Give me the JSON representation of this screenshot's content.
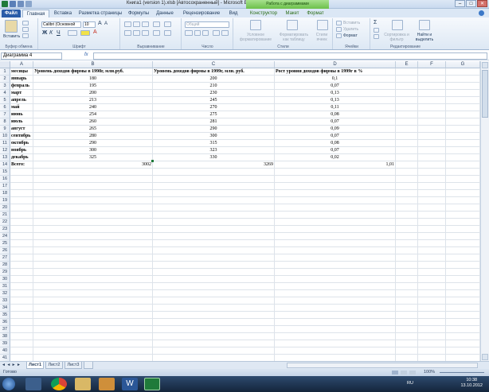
{
  "window": {
    "title": "Книга1 (version 1).xlsb [Автосохраненный] - Microsoft Excel",
    "context_title": "Работа с диаграммами"
  },
  "tabs": [
    {
      "id": "file",
      "label": "Файл"
    },
    {
      "id": "home",
      "label": "Главная"
    },
    {
      "id": "insert",
      "label": "Вставка"
    },
    {
      "id": "layout",
      "label": "Разметка страницы"
    },
    {
      "id": "formulas",
      "label": "Формулы"
    },
    {
      "id": "data",
      "label": "Данные"
    },
    {
      "id": "review",
      "label": "Рецензирование"
    },
    {
      "id": "view",
      "label": "Вид"
    },
    {
      "id": "design",
      "label": "Конструктор"
    },
    {
      "id": "chartlayout",
      "label": "Макет"
    },
    {
      "id": "format",
      "label": "Формат"
    }
  ],
  "ribbon": {
    "paste": "Вставить",
    "font_name": "Calibri (Основной",
    "font_size": "10",
    "number_format": "Общий",
    "cond_format": "Условное форматирование",
    "format_table": "Форматировать как таблицу",
    "cell_styles": "Стили ячеек",
    "insert": "Вставить",
    "delete": "Удалить",
    "format": "Формат",
    "sort": "Сортировка и фильтр",
    "find": "Найти и выделить",
    "groups": {
      "clipboard": "Буфер обмена",
      "font": "Шрифт",
      "alignment": "Выравнивание",
      "number": "Число",
      "styles": "Стили",
      "cells": "Ячейки",
      "editing": "Редактирование"
    }
  },
  "formula_bar": {
    "name_box": "Диаграмма 4",
    "fx": "fx",
    "value": ""
  },
  "columns": [
    "A",
    "B",
    "C",
    "D",
    "E",
    "F",
    "G"
  ],
  "rows": [
    "1",
    "2",
    "3",
    "4",
    "5",
    "6",
    "7",
    "8",
    "9",
    "10",
    "11",
    "12",
    "13",
    "14",
    "15",
    "16",
    "17",
    "18",
    "19",
    "20",
    "21",
    "22",
    "23",
    "24",
    "25",
    "26",
    "27",
    "28",
    "29",
    "30",
    "31",
    "32",
    "33",
    "34",
    "35",
    "36",
    "37",
    "38",
    "39",
    "40",
    "41"
  ],
  "sheet_data": {
    "headers": [
      "месяцы",
      "Уровень доходов фирмы в 1998г, млн.руб.",
      "Уровень доходов фирмы в 1999г, млн. руб.",
      "Рост уровня доходов фирмы в 1999г в %"
    ],
    "rows": [
      [
        "январь",
        "180",
        "200",
        "0,1"
      ],
      [
        "февраль",
        "195",
        "210",
        "0,07"
      ],
      [
        "март",
        "200",
        "230",
        "0,13"
      ],
      [
        "апрель",
        "213",
        "245",
        "0,13"
      ],
      [
        "май",
        "240",
        "270",
        "0,11"
      ],
      [
        "июнь",
        "254",
        "275",
        "0,08"
      ],
      [
        "июль",
        "260",
        "281",
        "0,07"
      ],
      [
        "август",
        "265",
        "290",
        "0,09"
      ],
      [
        "сентябрь",
        "280",
        "300",
        "0,07"
      ],
      [
        "октябрь",
        "290",
        "315",
        "0,08"
      ],
      [
        "ноябрь",
        "300",
        "323",
        "0,07"
      ],
      [
        "декабрь",
        "325",
        "330",
        "0,02"
      ]
    ],
    "total": [
      "Всего:",
      "3002",
      "3269",
      "1,01"
    ]
  },
  "sheets": [
    "Лист1",
    "Лист2",
    "Лист3"
  ],
  "status": {
    "ready": "Готово",
    "zoom": "100%"
  },
  "taskbar": {
    "lang": "RU",
    "time": "10:38",
    "date": "13.10.2012"
  },
  "colors": {
    "file_tab": "#2a5ca8",
    "context_green": "#6cc04a",
    "taskbar": "#1c314c"
  }
}
